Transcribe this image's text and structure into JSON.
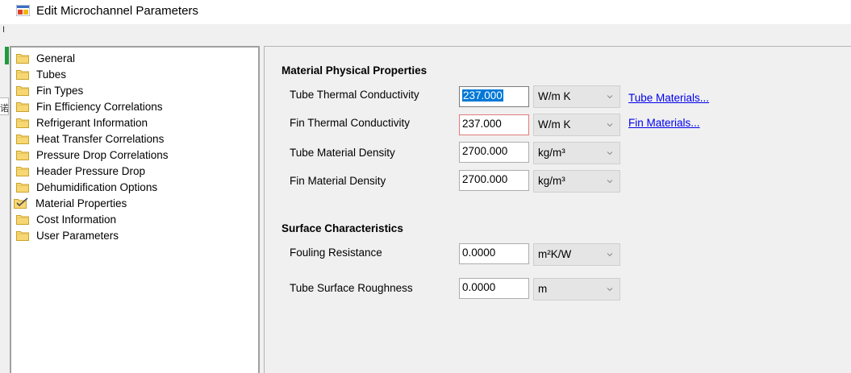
{
  "window": {
    "title": "Edit Microchannel Parameters"
  },
  "background_window": {
    "char1": "I",
    "char2": "诺"
  },
  "tree": {
    "items": [
      {
        "label": "General",
        "icon": "folder-icon"
      },
      {
        "label": "Tubes",
        "icon": "folder-icon"
      },
      {
        "label": "Fin Types",
        "icon": "folder-icon"
      },
      {
        "label": "Fin Efficiency Correlations",
        "icon": "folder-icon"
      },
      {
        "label": "Refrigerant Information",
        "icon": "folder-icon"
      },
      {
        "label": "Heat Transfer Correlations",
        "icon": "folder-icon"
      },
      {
        "label": "Pressure Drop Correlations",
        "icon": "folder-icon"
      },
      {
        "label": "Header Pressure Drop",
        "icon": "folder-icon"
      },
      {
        "label": "Dehumidification Options",
        "icon": "folder-icon"
      },
      {
        "label": "Material Properties",
        "icon": "folder-checked-icon"
      },
      {
        "label": "Cost Information",
        "icon": "folder-icon"
      },
      {
        "label": "User Parameters",
        "icon": "folder-icon"
      }
    ]
  },
  "material": {
    "title": "Material Physical Properties",
    "tube_conductivity": {
      "label": "Tube Thermal Conductivity",
      "value": "237.000",
      "unit": "W/m K",
      "link": "Tube Materials..."
    },
    "fin_conductivity": {
      "label": "Fin Thermal Conductivity",
      "value": "237.000",
      "unit": "W/m K",
      "link": "Fin Materials..."
    },
    "tube_density": {
      "label": "Tube Material Density",
      "value": "2700.000",
      "unit": "kg/m³"
    },
    "fin_density": {
      "label": "Fin Material Density",
      "value": "2700.000",
      "unit": "kg/m³"
    }
  },
  "surface": {
    "title": "Surface Characteristics",
    "fouling": {
      "label": "Fouling Resistance",
      "value": "0.0000",
      "unit": "m²K/W"
    },
    "roughness": {
      "label": "Tube Surface Roughness",
      "value": "0.0000",
      "unit": "m"
    }
  },
  "colors": {
    "selection": "#0078d7",
    "link": "#0000ee",
    "folder": "#f7d774"
  }
}
